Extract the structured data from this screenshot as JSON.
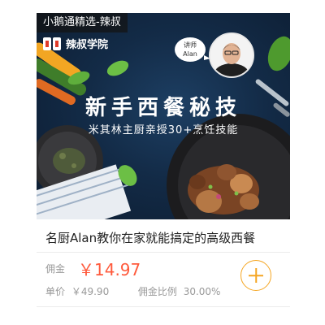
{
  "banner": {
    "source_tag": "小鹅通精选-辣叔",
    "brand_name": "辣叔学院",
    "teacher_badge_line1": "讲师",
    "teacher_badge_line2": "Alan",
    "headline": "新手西餐秘技",
    "subhead": "米其林主厨亲授30+烹饪技能"
  },
  "product": {
    "title": "名厨Alan教你在家就能搞定的高级西餐",
    "commission_label": "佣金",
    "commission_value": "￥14.97",
    "unit_price_label": "单价",
    "unit_price_value": "￥49.90",
    "commission_rate_label": "佣金比例",
    "commission_rate_value": "30.00%"
  },
  "colors": {
    "accent_price": "#ff5a3c",
    "add_button": "#f5a623",
    "banner_bg": "#132b47"
  },
  "icons": {
    "add": "plus-circle-icon",
    "brand": "brand-logo-icon"
  }
}
